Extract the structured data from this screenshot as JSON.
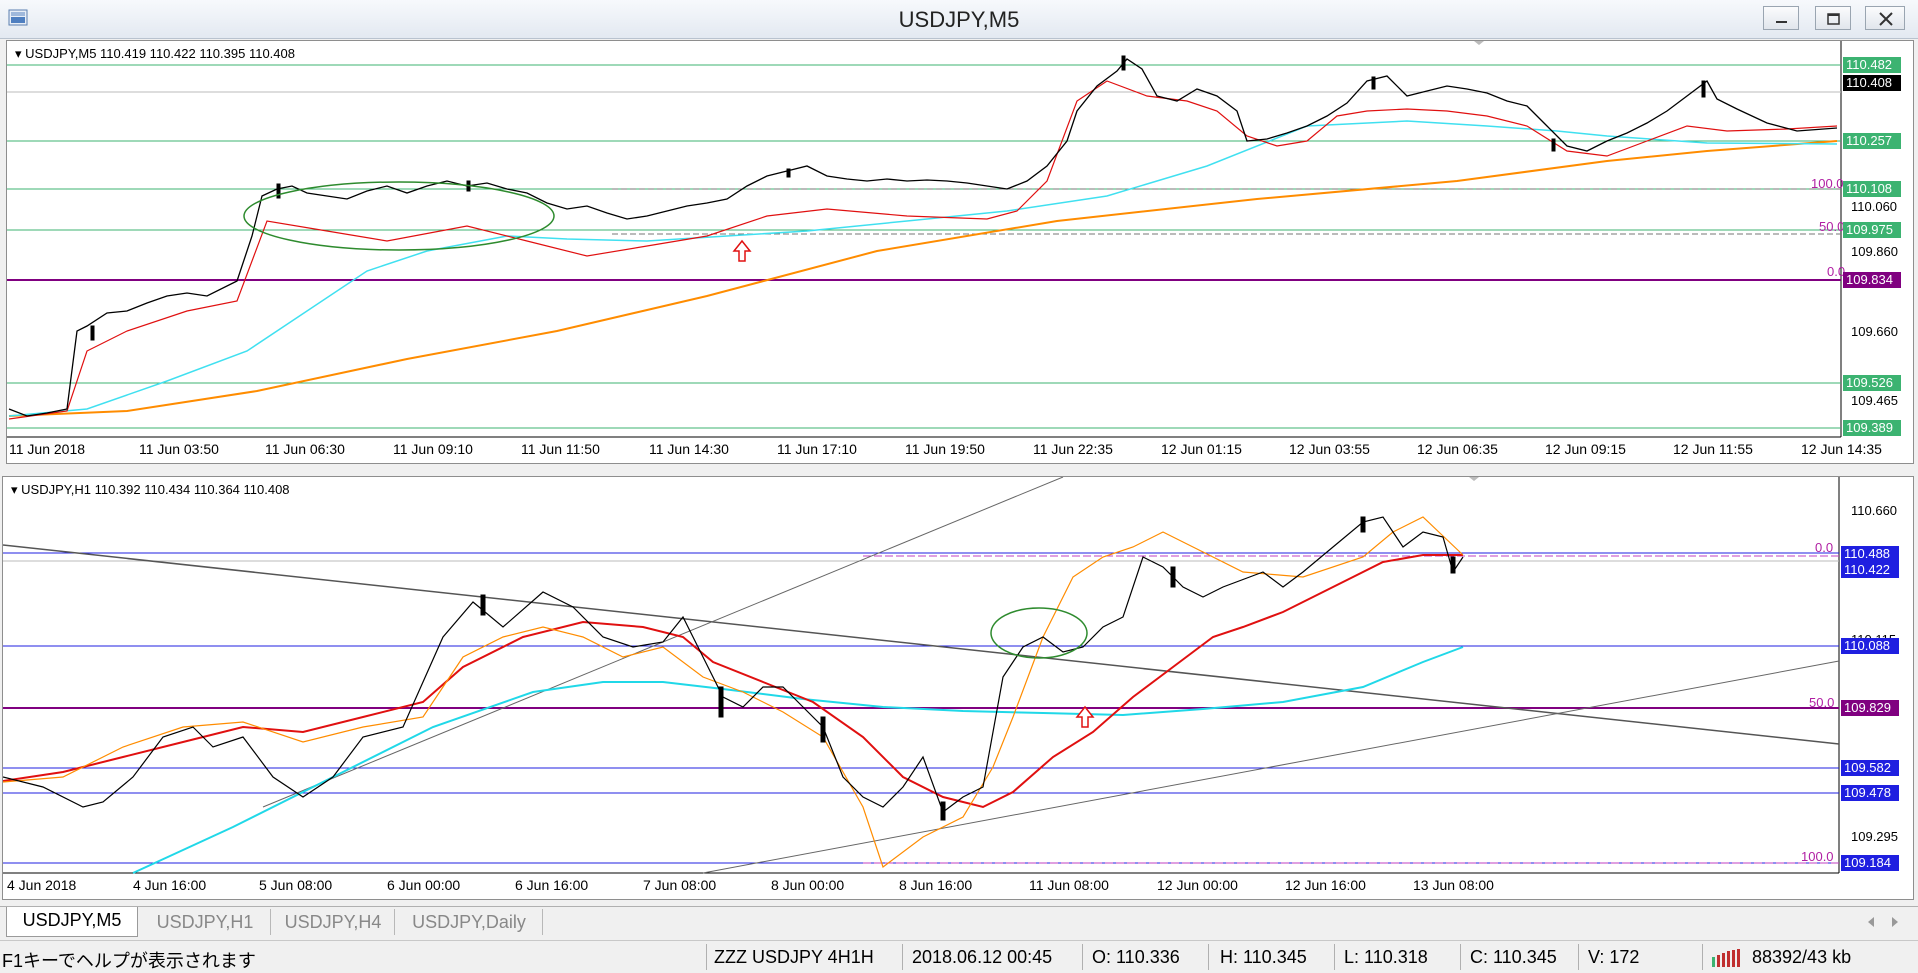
{
  "window": {
    "title": "USDJPY,M5"
  },
  "chart_top": {
    "header": "USDJPY,M5  110.419 110.422 110.395 110.408",
    "x_labels": [
      "11 Jun 2018",
      "11 Jun 03:50",
      "11 Jun 06:30",
      "11 Jun 09:10",
      "11 Jun 11:50",
      "11 Jun 14:30",
      "11 Jun 17:10",
      "11 Jun 19:50",
      "11 Jun 22:35",
      "12 Jun 01:15",
      "12 Jun 03:55",
      "12 Jun 06:35",
      "12 Jun 09:15",
      "12 Jun 11:55",
      "12 Jun 14:35"
    ],
    "y_labels": [
      "110.060",
      "109.860",
      "109.660",
      "109.465"
    ],
    "price_tags": [
      {
        "text": "110.482",
        "color": "#3cb371"
      },
      {
        "text": "110.408",
        "color": "#000000"
      },
      {
        "text": "110.257",
        "color": "#3cb371"
      },
      {
        "text": "110.108",
        "color": "#3cb371"
      },
      {
        "text": "109.975",
        "color": "#3cb371"
      },
      {
        "text": "109.834",
        "color": "#800080"
      },
      {
        "text": "109.526",
        "color": "#3cb371"
      },
      {
        "text": "109.389",
        "color": "#3cb371"
      }
    ],
    "fib_levels": [
      "100.0",
      "50.0",
      "0.0"
    ]
  },
  "chart_bottom": {
    "header": "USDJPY,H1  110.392 110.434 110.364 110.408",
    "x_labels": [
      "4 Jun 2018",
      "4 Jun 16:00",
      "5 Jun 08:00",
      "6 Jun 00:00",
      "6 Jun 16:00",
      "7 Jun 08:00",
      "8 Jun 00:00",
      "8 Jun 16:00",
      "11 Jun 08:00",
      "12 Jun 00:00",
      "12 Jun 16:00",
      "13 Jun 08:00"
    ],
    "y_labels": [
      "110.660",
      "110.115",
      "109.295"
    ],
    "price_tags": [
      {
        "text": "110.488",
        "color": "#1f1fe0"
      },
      {
        "text": "110.422",
        "color": "#1f1fe0"
      },
      {
        "text": "110.088",
        "color": "#1f1fe0"
      },
      {
        "text": "109.829",
        "color": "#800080"
      },
      {
        "text": "109.582",
        "color": "#1f1fe0"
      },
      {
        "text": "109.478",
        "color": "#1f1fe0"
      },
      {
        "text": "109.184",
        "color": "#1f1fe0"
      }
    ],
    "fib_levels": [
      "0.0",
      "50.0",
      "100.0"
    ]
  },
  "tabs": [
    "USDJPY,M5",
    "USDJPY,H1",
    "USDJPY,H4",
    "USDJPY,Daily"
  ],
  "status": {
    "help": "F1キーでヘルプが表示されます",
    "profile": "ZZZ USDJPY 4H1H",
    "datetime": "2018.06.12 00:45",
    "open": "O: 110.336",
    "high": "H: 110.345",
    "low": "L: 110.318",
    "close": "C: 110.345",
    "volume": "V: 172",
    "traffic": "88392/43 kb"
  }
}
